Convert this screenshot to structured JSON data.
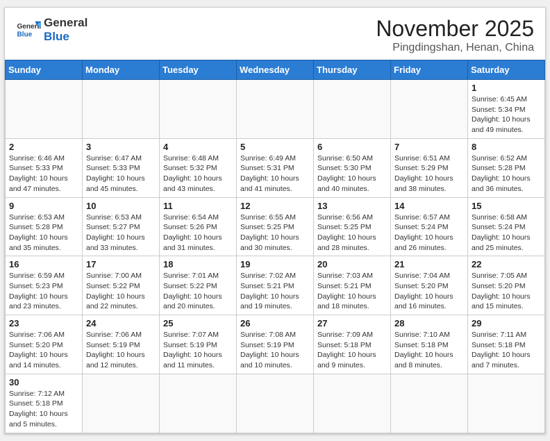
{
  "header": {
    "logo_general": "General",
    "logo_blue": "Blue",
    "month_title": "November 2025",
    "location": "Pingdingshan, Henan, China"
  },
  "weekdays": [
    "Sunday",
    "Monday",
    "Tuesday",
    "Wednesday",
    "Thursday",
    "Friday",
    "Saturday"
  ],
  "weeks": [
    [
      {
        "day": "",
        "info": ""
      },
      {
        "day": "",
        "info": ""
      },
      {
        "day": "",
        "info": ""
      },
      {
        "day": "",
        "info": ""
      },
      {
        "day": "",
        "info": ""
      },
      {
        "day": "",
        "info": ""
      },
      {
        "day": "1",
        "info": "Sunrise: 6:45 AM\nSunset: 5:34 PM\nDaylight: 10 hours and 49 minutes."
      }
    ],
    [
      {
        "day": "2",
        "info": "Sunrise: 6:46 AM\nSunset: 5:33 PM\nDaylight: 10 hours and 47 minutes."
      },
      {
        "day": "3",
        "info": "Sunrise: 6:47 AM\nSunset: 5:33 PM\nDaylight: 10 hours and 45 minutes."
      },
      {
        "day": "4",
        "info": "Sunrise: 6:48 AM\nSunset: 5:32 PM\nDaylight: 10 hours and 43 minutes."
      },
      {
        "day": "5",
        "info": "Sunrise: 6:49 AM\nSunset: 5:31 PM\nDaylight: 10 hours and 41 minutes."
      },
      {
        "day": "6",
        "info": "Sunrise: 6:50 AM\nSunset: 5:30 PM\nDaylight: 10 hours and 40 minutes."
      },
      {
        "day": "7",
        "info": "Sunrise: 6:51 AM\nSunset: 5:29 PM\nDaylight: 10 hours and 38 minutes."
      },
      {
        "day": "8",
        "info": "Sunrise: 6:52 AM\nSunset: 5:28 PM\nDaylight: 10 hours and 36 minutes."
      }
    ],
    [
      {
        "day": "9",
        "info": "Sunrise: 6:53 AM\nSunset: 5:28 PM\nDaylight: 10 hours and 35 minutes."
      },
      {
        "day": "10",
        "info": "Sunrise: 6:53 AM\nSunset: 5:27 PM\nDaylight: 10 hours and 33 minutes."
      },
      {
        "day": "11",
        "info": "Sunrise: 6:54 AM\nSunset: 5:26 PM\nDaylight: 10 hours and 31 minutes."
      },
      {
        "day": "12",
        "info": "Sunrise: 6:55 AM\nSunset: 5:25 PM\nDaylight: 10 hours and 30 minutes."
      },
      {
        "day": "13",
        "info": "Sunrise: 6:56 AM\nSunset: 5:25 PM\nDaylight: 10 hours and 28 minutes."
      },
      {
        "day": "14",
        "info": "Sunrise: 6:57 AM\nSunset: 5:24 PM\nDaylight: 10 hours and 26 minutes."
      },
      {
        "day": "15",
        "info": "Sunrise: 6:58 AM\nSunset: 5:24 PM\nDaylight: 10 hours and 25 minutes."
      }
    ],
    [
      {
        "day": "16",
        "info": "Sunrise: 6:59 AM\nSunset: 5:23 PM\nDaylight: 10 hours and 23 minutes."
      },
      {
        "day": "17",
        "info": "Sunrise: 7:00 AM\nSunset: 5:22 PM\nDaylight: 10 hours and 22 minutes."
      },
      {
        "day": "18",
        "info": "Sunrise: 7:01 AM\nSunset: 5:22 PM\nDaylight: 10 hours and 20 minutes."
      },
      {
        "day": "19",
        "info": "Sunrise: 7:02 AM\nSunset: 5:21 PM\nDaylight: 10 hours and 19 minutes."
      },
      {
        "day": "20",
        "info": "Sunrise: 7:03 AM\nSunset: 5:21 PM\nDaylight: 10 hours and 18 minutes."
      },
      {
        "day": "21",
        "info": "Sunrise: 7:04 AM\nSunset: 5:20 PM\nDaylight: 10 hours and 16 minutes."
      },
      {
        "day": "22",
        "info": "Sunrise: 7:05 AM\nSunset: 5:20 PM\nDaylight: 10 hours and 15 minutes."
      }
    ],
    [
      {
        "day": "23",
        "info": "Sunrise: 7:06 AM\nSunset: 5:20 PM\nDaylight: 10 hours and 14 minutes."
      },
      {
        "day": "24",
        "info": "Sunrise: 7:06 AM\nSunset: 5:19 PM\nDaylight: 10 hours and 12 minutes."
      },
      {
        "day": "25",
        "info": "Sunrise: 7:07 AM\nSunset: 5:19 PM\nDaylight: 10 hours and 11 minutes."
      },
      {
        "day": "26",
        "info": "Sunrise: 7:08 AM\nSunset: 5:19 PM\nDaylight: 10 hours and 10 minutes."
      },
      {
        "day": "27",
        "info": "Sunrise: 7:09 AM\nSunset: 5:18 PM\nDaylight: 10 hours and 9 minutes."
      },
      {
        "day": "28",
        "info": "Sunrise: 7:10 AM\nSunset: 5:18 PM\nDaylight: 10 hours and 8 minutes."
      },
      {
        "day": "29",
        "info": "Sunrise: 7:11 AM\nSunset: 5:18 PM\nDaylight: 10 hours and 7 minutes."
      }
    ],
    [
      {
        "day": "30",
        "info": "Sunrise: 7:12 AM\nSunset: 5:18 PM\nDaylight: 10 hours and 5 minutes."
      },
      {
        "day": "",
        "info": ""
      },
      {
        "day": "",
        "info": ""
      },
      {
        "day": "",
        "info": ""
      },
      {
        "day": "",
        "info": ""
      },
      {
        "day": "",
        "info": ""
      },
      {
        "day": "",
        "info": ""
      }
    ]
  ]
}
